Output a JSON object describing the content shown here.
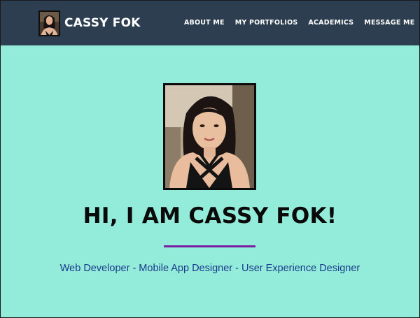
{
  "brand": {
    "name": "CASSY FOK"
  },
  "nav": {
    "items": [
      {
        "label": "ABOUT ME"
      },
      {
        "label": "MY PORTFOLIOS"
      },
      {
        "label": "ACADEMICS"
      },
      {
        "label": "MESSAGE ME"
      }
    ]
  },
  "hero": {
    "title": "HI, I AM CASSY FOK!",
    "subtitle": "Web Developer - Mobile App Designer - User Experience Designer"
  },
  "colors": {
    "navbar": "#2c3e50",
    "background": "#93ebd9",
    "divider": "#7b1fa2",
    "subtitle": "#1a3a8c"
  }
}
